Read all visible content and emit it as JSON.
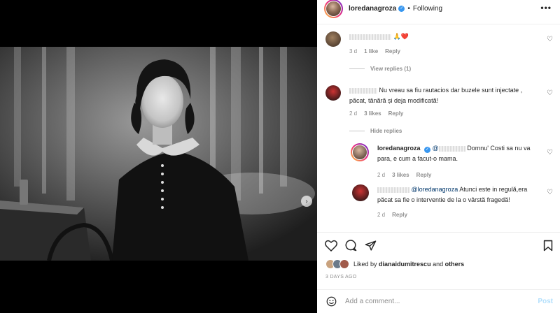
{
  "header": {
    "username": "loredanagroza",
    "separator": "•",
    "follow_status": "Following",
    "more_label": "•••"
  },
  "media": {
    "carousel_count": 10,
    "active_index": 0
  },
  "comments": [
    {
      "text": "🙏❤️",
      "age": "3 d",
      "likes": "1 like",
      "reply": "Reply",
      "replies_toggle": "View replies (1)"
    },
    {
      "text": "Nu vreau sa fiu rautacios dar buzele sunt injectate , păcat, tânără și deja modificată!",
      "age": "2 d",
      "likes": "3 likes",
      "reply": "Reply",
      "replies_toggle": "Hide replies"
    }
  ],
  "replies": [
    {
      "user": "loredanagroza",
      "mention": "@",
      "text": " Domnu' Costi sa nu va para, e cum a facut-o mama.",
      "age": "2 d",
      "likes": "3 likes",
      "reply": "Reply"
    },
    {
      "mention": "@loredanagroza",
      "text": " Atunci este in regulă,era păcat sa fie o interventie de la o vârstă fragedă!",
      "age": "2 d",
      "reply": "Reply"
    }
  ],
  "likes_line": {
    "prefix": "Liked by",
    "user": "dianaidumitrescu",
    "and": "and",
    "others": "others"
  },
  "post_date": "3 DAYS AGO",
  "comment_box": {
    "placeholder": "Add a comment...",
    "post_label": "Post"
  },
  "colors": {
    "link_blue": "#3897f0",
    "mention_blue": "#00376b",
    "post_disabled": "#b2dffc",
    "muted": "#8e8e8e"
  }
}
